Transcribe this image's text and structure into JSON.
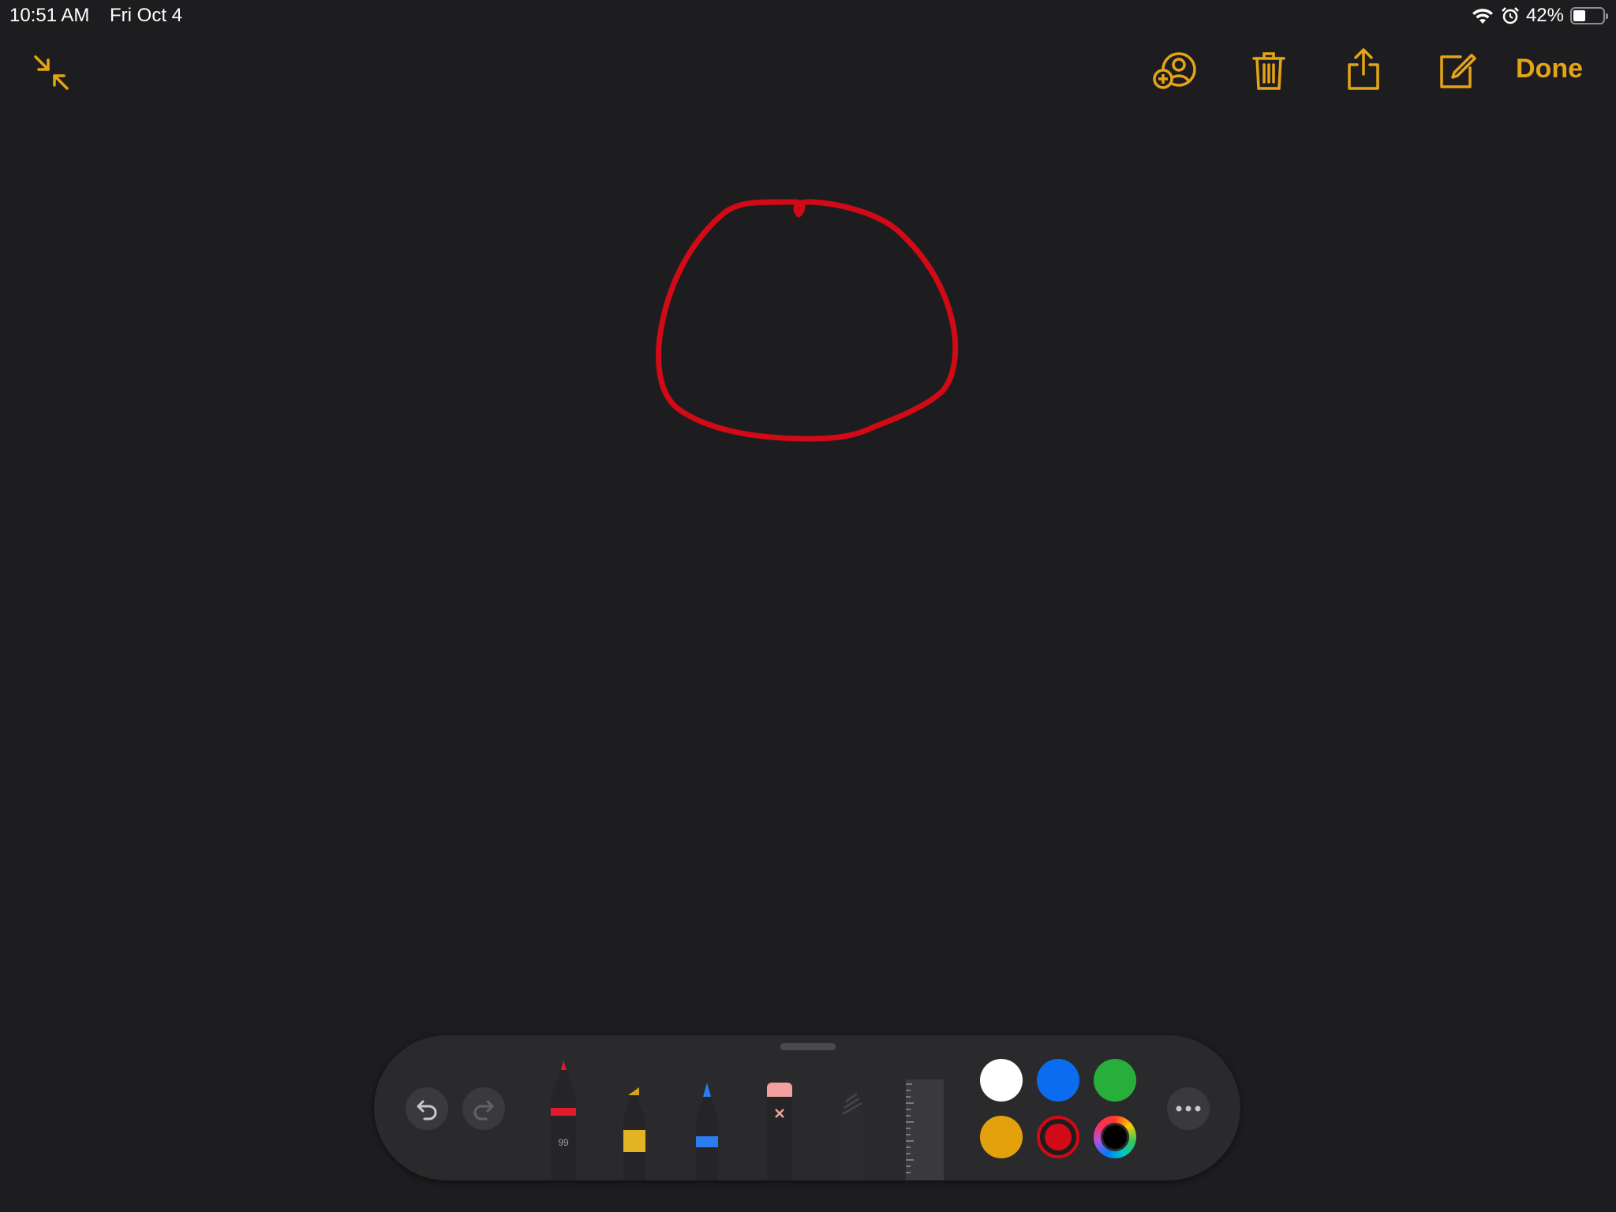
{
  "status_bar": {
    "time": "10:51 AM",
    "date": "Fri Oct 4",
    "battery_percent": "42%",
    "battery_level": 0.42,
    "icons": [
      "wifi-icon",
      "alarm-icon",
      "battery-icon"
    ]
  },
  "toolbar": {
    "left": [
      "collapse-icon"
    ],
    "right": [
      "add-collaborator-icon",
      "trash-icon",
      "share-icon",
      "compose-icon"
    ],
    "done_label": "Done",
    "accent_color": "#e5a417"
  },
  "drawing": {
    "stroke_color": "#d10a16",
    "shape": "hand-drawn circle"
  },
  "tool_palette": {
    "undo": "undo-icon",
    "redo": "redo-icon",
    "tools": [
      {
        "name": "pen",
        "color": "#e0192b",
        "label": "99",
        "selected": true
      },
      {
        "name": "marker",
        "color": "#e8b820"
      },
      {
        "name": "pencil-tip",
        "color": "#2b7cf0"
      },
      {
        "name": "eraser",
        "color": "#f2a0a0"
      },
      {
        "name": "pencil",
        "color": "#3a3a3c"
      },
      {
        "name": "ruler",
        "color": "#3a3a3c"
      }
    ],
    "colors": [
      {
        "name": "white",
        "hex": "#ffffff"
      },
      {
        "name": "blue",
        "hex": "#0a6cf0"
      },
      {
        "name": "green",
        "hex": "#27ae3b"
      },
      {
        "name": "yellow",
        "hex": "#e3a20b"
      },
      {
        "name": "red",
        "hex": "#d10a16",
        "selected": true
      },
      {
        "name": "color-picker",
        "hex": "#000000"
      }
    ],
    "more": "more-icon"
  }
}
